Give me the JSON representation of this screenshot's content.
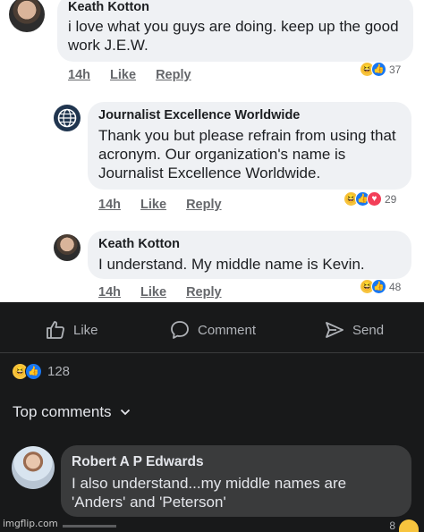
{
  "thread": {
    "comment1": {
      "author": "Keath Kotton",
      "text": "i love what you guys are doing.  keep up the good work J.E.W.",
      "time": "14h",
      "like_label": "Like",
      "reply_label": "Reply",
      "reaction_count": "37",
      "reactions": [
        "haha",
        "like"
      ]
    },
    "reply1": {
      "author": "Journalist Excellence Worldwide",
      "text": "Thank you but please refrain from using that acronym. Our organization's name is Journalist Excellence Worldwide.",
      "time": "14h",
      "like_label": "Like",
      "reply_label": "Reply",
      "reaction_count": "29",
      "reactions": [
        "haha",
        "like",
        "love"
      ]
    },
    "reply2": {
      "author": "Keath Kotton",
      "text": "I understand.  My middle name is Kevin.",
      "time": "14h",
      "like_label": "Like",
      "reply_label": "Reply",
      "reaction_count": "48",
      "reactions": [
        "haha",
        "like"
      ]
    }
  },
  "post_actions": {
    "like_label": "Like",
    "comment_label": "Comment",
    "send_label": "Send"
  },
  "post_reactions": {
    "count": "128",
    "reactions": [
      "haha",
      "like"
    ]
  },
  "comments_filter": {
    "label": "Top comments"
  },
  "top_comment": {
    "author": "Robert A P Edwards",
    "text": "I also understand...my middle names are 'Anders' and 'Peterson'",
    "partial_reaction_count": "8"
  },
  "watermark": "imgflip.com",
  "colors": {
    "like_blue": "#1877f2",
    "haha_yellow": "#f7c43e",
    "love_red": "#f33e58",
    "dark_bg": "#18191a",
    "bubble_light": "#eff1f4",
    "bubble_dark": "#3a3b3c"
  }
}
